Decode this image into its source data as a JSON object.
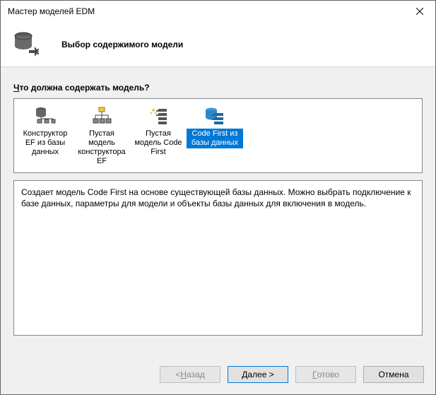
{
  "window": {
    "title": "Мастер моделей EDM"
  },
  "banner": {
    "heading": "Выбор содержимого модели"
  },
  "prompt": {
    "prefix": "Ч",
    "rest": "то должна содержать модель?"
  },
  "options": [
    {
      "label": "Конструктор EF из базы данных",
      "selected": false,
      "icon": "db-designer"
    },
    {
      "label": "Пустая модель конструктора EF",
      "selected": false,
      "icon": "empty-designer"
    },
    {
      "label": "Пустая модель Code First",
      "selected": false,
      "icon": "empty-codefirst"
    },
    {
      "label": "Code First из базы данных",
      "selected": true,
      "icon": "codefirst-db"
    }
  ],
  "description": "Создает модель Code First на основе существующей базы данных. Можно выбрать подключение к базе данных, параметры для модели и объекты базы данных для включения в модель.",
  "buttons": {
    "back_prefix": "< ",
    "back_mn": "Н",
    "back_rest": "азад",
    "next_mn": "Д",
    "next_rest": "алее >",
    "finish_mn": "Г",
    "finish_rest": "отово",
    "cancel": "Отмена"
  }
}
